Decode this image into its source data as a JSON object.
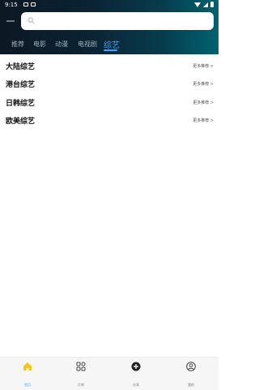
{
  "status_bar": {
    "time": "9:15"
  },
  "colors": {
    "accent": "#3aa6ff",
    "home_icon": "#f5c518"
  },
  "tabs": [
    {
      "label": "推荐"
    },
    {
      "label": "电影"
    },
    {
      "label": "动漫"
    },
    {
      "label": "电视剧"
    },
    {
      "label": "综艺",
      "active": true
    }
  ],
  "sections": [
    {
      "title": "大陆综艺",
      "more": "更多推荐 >"
    },
    {
      "title": "港台综艺",
      "more": "更多推荐 >"
    },
    {
      "title": "日韩综艺",
      "more": "更多推荐 >"
    },
    {
      "title": "欧美综艺",
      "more": "更多推荐 >"
    }
  ],
  "bottom_nav": [
    {
      "label": "首页",
      "icon": "home-icon",
      "active": true
    },
    {
      "label": "片库",
      "icon": "grid-icon"
    },
    {
      "label": "分享",
      "icon": "plus-circle-icon"
    },
    {
      "label": "我的",
      "icon": "user-icon"
    }
  ]
}
